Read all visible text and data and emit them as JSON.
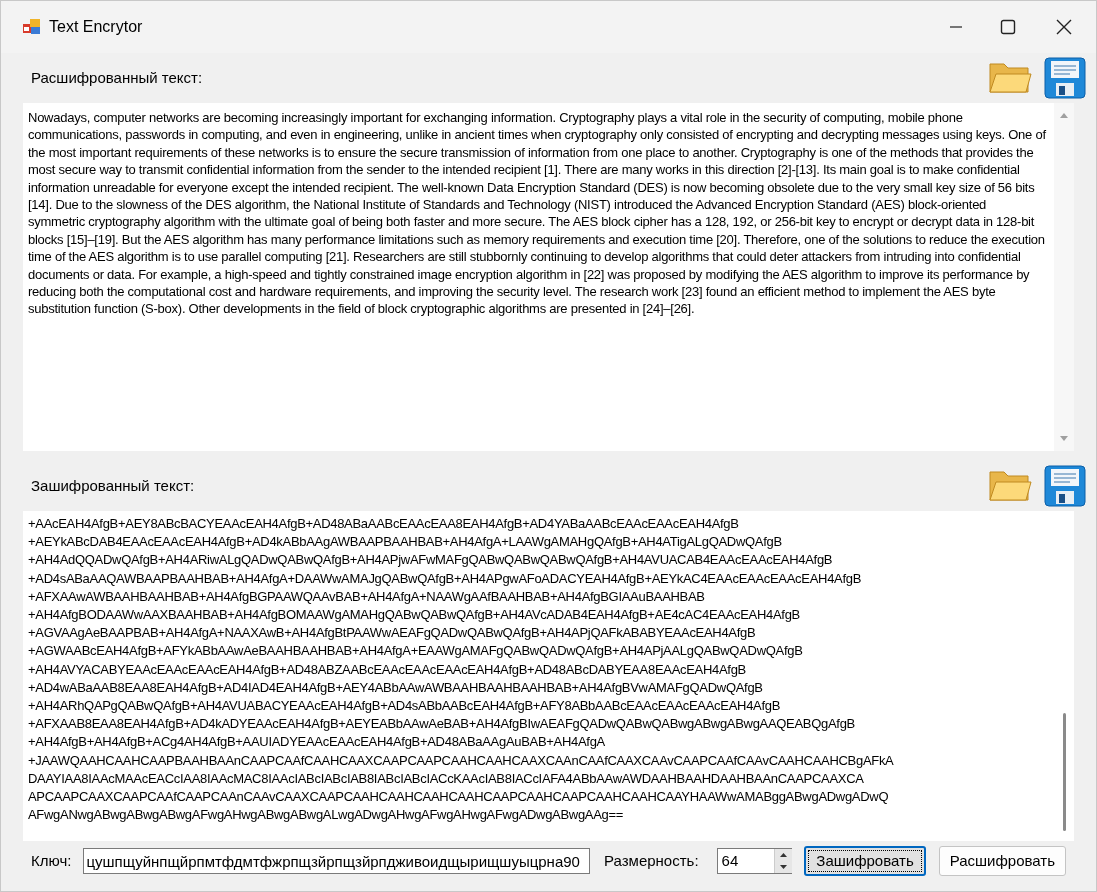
{
  "window": {
    "title": "Text Encrytor"
  },
  "decrypted": {
    "label": "Расшифрованный текст:",
    "text": "Nowadays, computer networks are becoming increasingly important for exchanging information. Cryptography plays a vital role in the security of computing, mobile phone communications, passwords in computing, and even in engineering, unlike in ancient times when cryptography only consisted of encrypting and decrypting messages using keys. One of the most important requirements of these networks is to ensure the secure transmission of information from one place to another. Cryptography is one of the methods that provides the most secure way to transmit confidential information from the sender to the intended recipient [1]. There are many works in this direction [2]-[13]. Its main goal is to make confidential information unreadable for everyone except the intended recipient. The well-known Data Encryption Standard (DES) is now becoming obsolete due to the very small key size of 56 bits [14]. Due to the slowness of the DES algorithm, the National Institute of Standards and Technology (NIST) introduced the Advanced Encryption Standard (AES) block-oriented symmetric cryptography algorithm with the ultimate goal of being both faster and more secure. The AES block cipher has a 128, 192, or 256-bit key to encrypt or decrypt data in 128-bit blocks [15]–[19]. But the AES algorithm has many performance limitations such as memory requirements and execution time [20]. Therefore, one of the solutions to reduce the execution time of the AES algorithm is to use parallel computing [21]. Researchers are still stubbornly continuing to develop algorithms that could deter attackers from intruding into confidential documents or data. For example, a high-speed and tightly constrained image encryption algorithm in [22] was proposed by modifying the AES algorithm to improve its performance by reducing both the computational cost and hardware requirements, and improving the security level. The research work [23] found an efficient method to implement the AES byte substitution function (S-box). Other developments in the field of block cryptographic algorithms are presented in [24]–[26]."
  },
  "encrypted": {
    "label": "Зашифрованный текст:",
    "lines": [
      "+AAcEAH4AfgB+AEY8ABcBACYEAAcEAH4AfgB+AD48ABaAABcEAAcEAA8EAH4AfgB+AD4YABaAABcEAAcEAAcEAH4AfgB",
      "+AEYkABcDAB4EAAcEAAcEAH4AfgB+AD4kABbAAgAWBAAPBAAHBAB+AH4AfgA+LAAWgAMAHgQAfgB+AH4ATigALgQADwQAfgB",
      "+AH4AdQQADwQAfgB+AH4ARiwALgQADwQABwQAfgB+AH4APjwAFwMAFgQABwQABwQABwQAfgB+AH4AVUACAB4EAAcEAAcEAH4AfgB",
      "+AD4sABaAAQAWBAAPBAAHBAB+AH4AfgA+DAAWwAMAJgQABwQAfgB+AH4APgwAFoADACYEAH4AfgB+AEYkAC4EAAcEAAcEAAcEAH4AfgB",
      "+AFXAAwAWBAAHBAAHBAB+AH4AfgBGPAAWQAAvBAB+AH4AfgA+NAAWgAAfBAAHBAB+AH4AfgBGIAAuBAAHBAB",
      "+AH4AfgBODAAWwAAXBAAHBAB+AH4AfgBOMAAWgAMAHgQABwQABwQAfgB+AH4AVcADAB4EAH4AfgB+AE4cAC4EAAcEAH4AfgB",
      "+AGVAAgAeBAAPBAB+AH4AfgA+NAAXAwB+AH4AfgBtPAAWwAEAFgQADwQABwQAfgB+AH4APjQAFkABABYEAAcEAH4AfgB",
      "+AGWAABcEAH4AfgB+AFYkABbAAwAeBAAHBAAHBAB+AH4AfgA+EAAWgAMAFgQABwQADwQAfgB+AH4APjAALgQABwQADwQAfgB",
      "+AH4AVYACABYEAAcEAAcEAAcEAH4AfgB+AD48ABZAABcEAAcEAAcEAAcEAH4AfgB+AD48ABcDABYEAA8EAAcEAH4AfgB",
      "+AD4wABaAAB8EAA8EAH4AfgB+AD4IAD4EAH4AfgB+AEY4ABbAAwAWBAAHBAAHBAAHBAB+AH4AfgBVwAMAFgQADwQAfgB",
      "+AH4ARhQAPgQABwQAfgB+AH4AVUABACYEAAcEAH4AfgB+AD4sABbAABcEAH4AfgB+AFY8ABbAABcEAAcEAAcEAAcEAH4AfgB",
      "+AFXAAB8EAA8EAH4AfgB+AD4kADYEAAcEAH4AfgB+AEYEABbAAwAeBAB+AH4AfgBIwAEAFgQADwQABwQABwgABwgABwgAAQEABQgAfgB",
      "+AH4AfgB+AH4AfgB+ACg4AH4AfgB+AAUIADYEAAcEAAcEAH4AfgB+AD48ABaAAgAuBAB+AH4AfgA",
      "+JAAWQAAHCAAHCAAPBAAHBAAnCAAPCAAfCAAHCAAXCAAPCAAPCAAHCAAHCAAXCAAnCAAfCAAXCAAvCAAPCAAfCAAvCAAHCAAHCBgAFkA",
      "DAAYIAA8IAAcMAAcEACcIAA8IAAcMAC8IAAcIABcIABcIAB8IABcIABcIACcKAAcIAB8IACcIAFA4ABbAAwAWDAAHBAAHDAAHBAAnCAAPCAAXCA",
      "APCAAPCAAXCAAPCAAfCAAPCAAnCAAvCAAXCAAPCAAHCAAHCAAHCAAHCAAPCAAHCAAPCAAHCAAHCAAYHAAWwAMABggABwgADwgADwQ",
      "AFwgANwgABwgABwgABwgAFwgAHwgABwgABwgALwgADwgAHwgAFwgAHwgAFwgADwgABwgAAg=="
    ]
  },
  "key": {
    "label": "Ключ:",
    "value": "цушпщуйнпщйрпмтфдмтфжрпщзйрпщзйрпдживоидщырищшуыцрна90"
  },
  "size": {
    "label": "Размерность:",
    "value": "64"
  },
  "buttons": [
    {
      "label": "Зашифровать",
      "focused": true
    },
    {
      "label": "Расшифровать",
      "focused": false
    }
  ]
}
